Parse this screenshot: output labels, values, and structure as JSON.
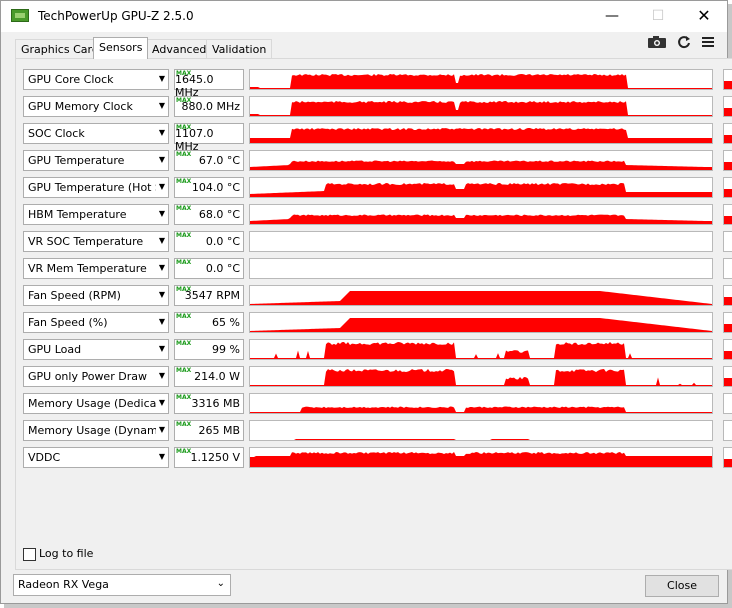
{
  "window": {
    "title": "TechPowerUp GPU-Z 2.5.0",
    "min_glyph": "—",
    "max_glyph": "☐",
    "close_glyph": "✕"
  },
  "tabs": [
    {
      "label": "Graphics Card",
      "active": false
    },
    {
      "label": "Sensors",
      "active": true
    },
    {
      "label": "Advanced",
      "active": false
    },
    {
      "label": "Validation",
      "active": false
    }
  ],
  "toolbar": {
    "camera_icon": "camera-icon",
    "refresh_icon": "refresh-icon",
    "menu_icon": "menu-icon"
  },
  "sensors": [
    {
      "name": "GPU Core Clock",
      "value": "1645.0 MHz",
      "mode": "MAX",
      "pattern": "clock"
    },
    {
      "name": "GPU Memory Clock",
      "value": "880.0 MHz",
      "mode": "MAX",
      "pattern": "clock"
    },
    {
      "name": "SOC Clock",
      "value": "1107.0 MHz",
      "mode": "MAX",
      "pattern": "soc"
    },
    {
      "name": "GPU Temperature",
      "value": "67.0 °C",
      "mode": "MAX",
      "pattern": "temp"
    },
    {
      "name": "GPU Temperature (Hot Spot)",
      "value": "104.0 °C",
      "mode": "MAX",
      "pattern": "hotspot"
    },
    {
      "name": "HBM Temperature",
      "value": "68.0 °C",
      "mode": "MAX",
      "pattern": "temp"
    },
    {
      "name": "VR SOC Temperature",
      "value": "0.0 °C",
      "mode": "MAX",
      "pattern": "empty"
    },
    {
      "name": "VR Mem Temperature",
      "value": "0.0 °C",
      "mode": "MAX",
      "pattern": "empty"
    },
    {
      "name": "Fan Speed (RPM)",
      "value": "3547 RPM",
      "mode": "MAX",
      "pattern": "fan"
    },
    {
      "name": "Fan Speed (%)",
      "value": "65 %",
      "mode": "MAX",
      "pattern": "fan"
    },
    {
      "name": "GPU Load",
      "value": "99 %",
      "mode": "MAX",
      "pattern": "load"
    },
    {
      "name": "GPU only Power Draw",
      "value": "214.0 W",
      "mode": "MAX",
      "pattern": "load"
    },
    {
      "name": "Memory Usage (Dedicated)",
      "value": "3316 MB",
      "mode": "MAX",
      "pattern": "mem"
    },
    {
      "name": "Memory Usage (Dynamic)",
      "value": "265 MB",
      "mode": "MAX",
      "pattern": "dyn"
    },
    {
      "name": "VDDC",
      "value": "1.1250 V",
      "mode": "MAX",
      "pattern": "vddc"
    }
  ],
  "log_to_file": {
    "label": "Log to file",
    "checked": false
  },
  "gpu_select": {
    "value": "Radeon RX Vega"
  },
  "close_button": {
    "label": "Close"
  },
  "colors": {
    "graph": "#ff0000",
    "max_badge": "#1a9a1a"
  }
}
